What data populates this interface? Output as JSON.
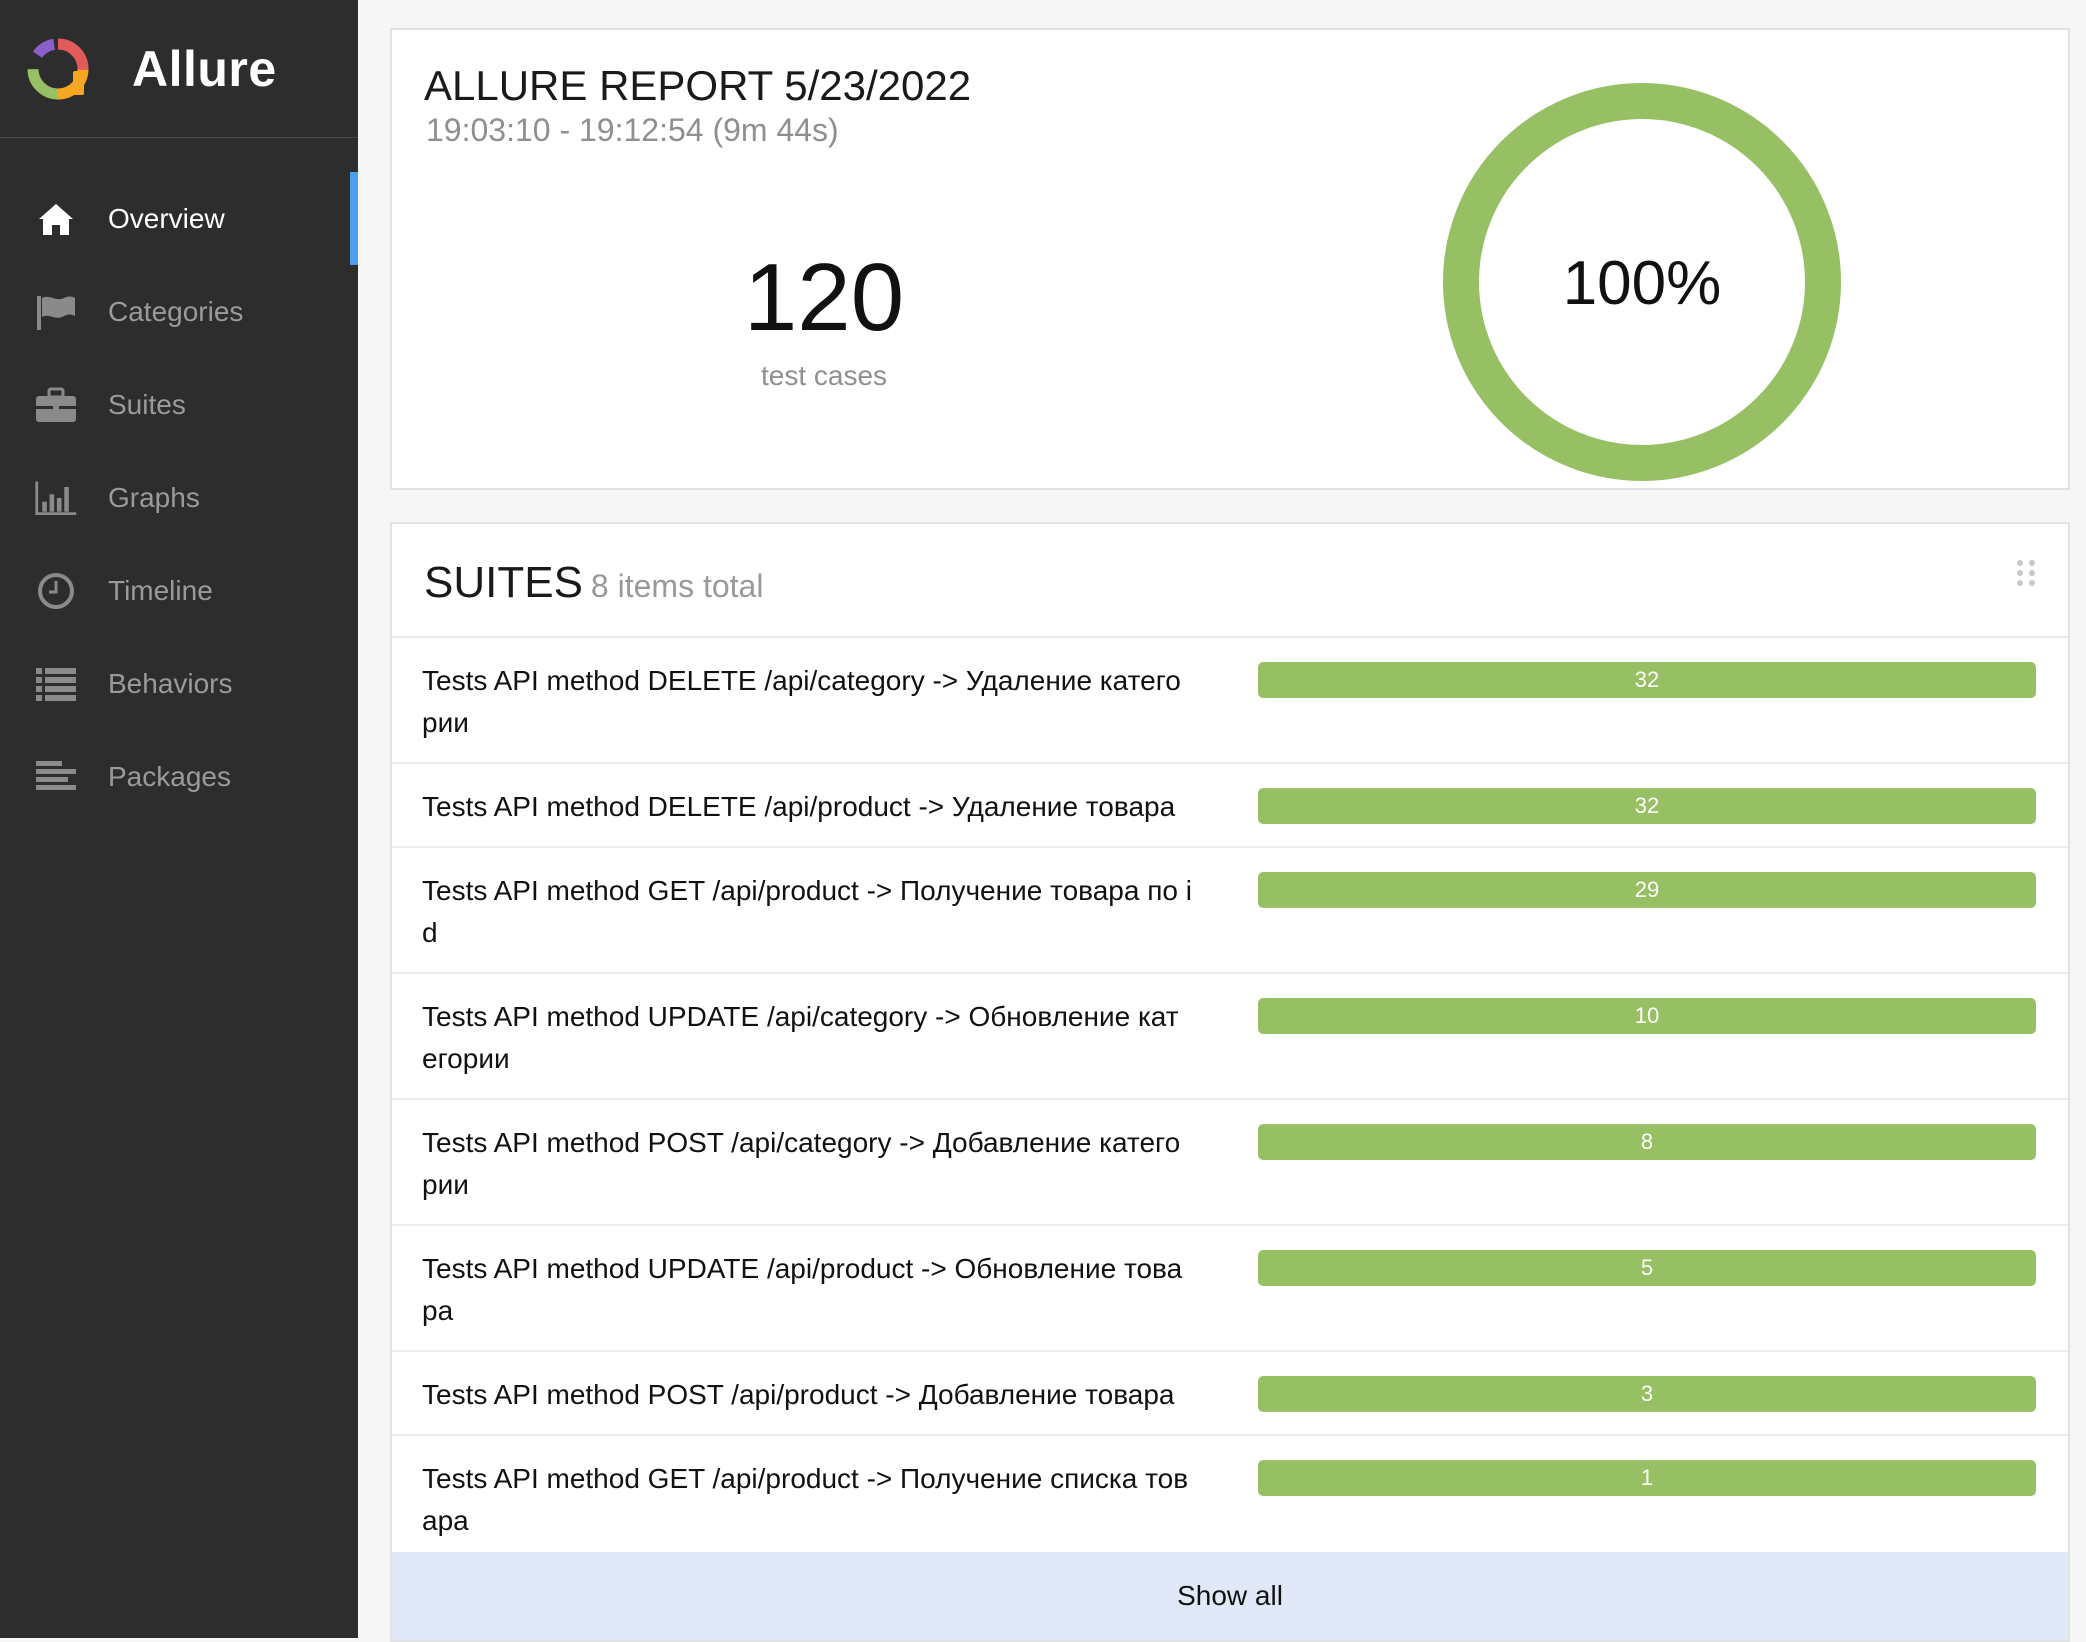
{
  "brand": {
    "name": "Allure"
  },
  "nav": [
    {
      "label": "Overview",
      "icon": "home-icon",
      "active": true
    },
    {
      "label": "Categories",
      "icon": "flag-icon"
    },
    {
      "label": "Suites",
      "icon": "briefcase-icon"
    },
    {
      "label": "Graphs",
      "icon": "bar-chart-icon"
    },
    {
      "label": "Timeline",
      "icon": "clock-icon"
    },
    {
      "label": "Behaviors",
      "icon": "list-icon"
    },
    {
      "label": "Packages",
      "icon": "align-left-icon"
    }
  ],
  "report": {
    "title": "ALLURE REPORT 5/23/2022",
    "time": "19:03:10 - 19:12:54 (9m 44s)",
    "count": "120",
    "count_label": "test cases",
    "success_rate": "100%",
    "success_fraction": 1.0,
    "color": "#97c065"
  },
  "suites": {
    "title": "SUITES",
    "total": "8 items total",
    "show_all": "Show all",
    "items": [
      {
        "name": "Tests API method DELETE /api/category -> Удаление катего рии",
        "count": "32",
        "fraction": 1.0
      },
      {
        "name": "Tests API method DELETE /api/product -> Удаление товара",
        "count": "32",
        "fraction": 1.0
      },
      {
        "name": "Tests API method GET /api/product -> Получение товара по i d",
        "count": "29",
        "fraction": 1.0
      },
      {
        "name": "Tests API method UPDATE /api/category -> Обновление кат егории",
        "count": "10",
        "fraction": 1.0
      },
      {
        "name": "Tests API method POST /api/category -> Добавление катего рии",
        "count": "8",
        "fraction": 1.0
      },
      {
        "name": "Tests API method UPDATE /api/product -> Обновление това ра",
        "count": "5",
        "fraction": 1.0
      },
      {
        "name": "Tests API method POST /api/product -> Добавление товара",
        "count": "3",
        "fraction": 1.0
      },
      {
        "name": "Tests API method GET /api/product -> Получение списка тов ара",
        "count": "1",
        "fraction": 1.0
      }
    ]
  }
}
